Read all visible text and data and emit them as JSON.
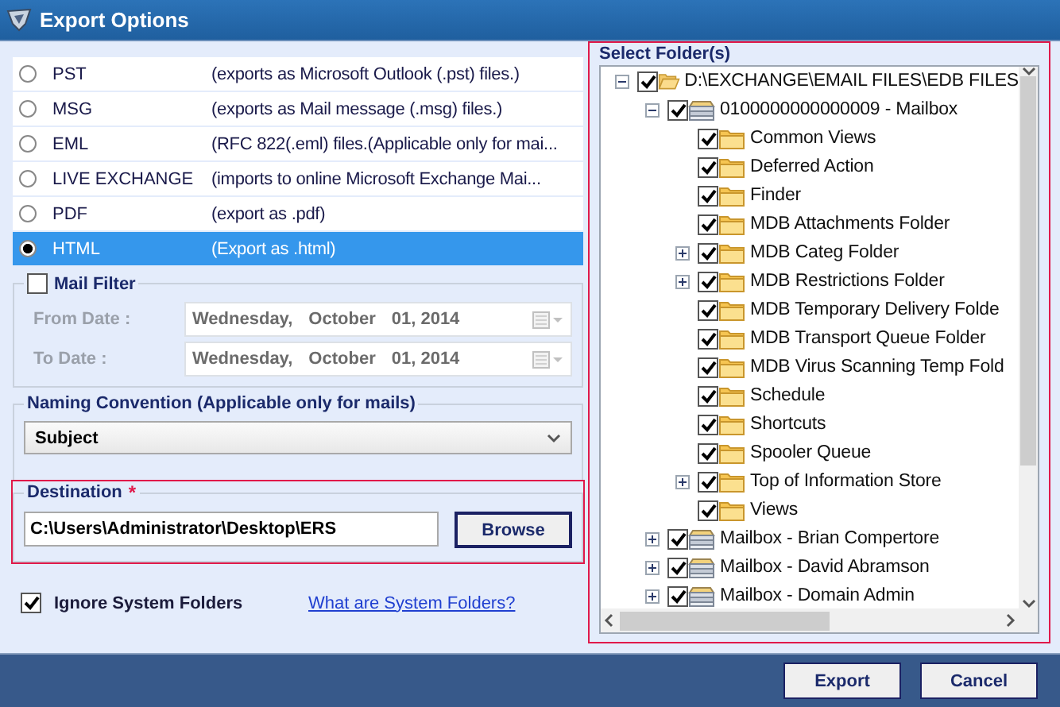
{
  "window": {
    "title": "Export Options"
  },
  "formats": [
    {
      "label": "PST",
      "description": "(exports as Microsoft Outlook (.pst) files.)",
      "selected": false
    },
    {
      "label": "MSG",
      "description": "(exports as Mail message (.msg) files.)",
      "selected": false
    },
    {
      "label": "EML",
      "description": "(RFC 822(.eml) files.(Applicable only for mai...",
      "selected": false
    },
    {
      "label": "LIVE EXCHANGE",
      "description": "(imports to online Microsoft Exchange Mai...",
      "selected": false
    },
    {
      "label": "PDF",
      "description": "(export as .pdf)",
      "selected": false
    },
    {
      "label": "HTML",
      "description": "(Export as .html)",
      "selected": true
    }
  ],
  "mail_filter": {
    "label": "Mail Filter",
    "checked": false,
    "dates": [
      {
        "label": "From Date :",
        "weekday": "Wednesday,",
        "month": "October",
        "day_year": "01, 2014"
      },
      {
        "label": "To Date :",
        "weekday": "Wednesday,",
        "month": "October",
        "day_year": "01, 2014"
      }
    ]
  },
  "naming": {
    "legend": "Naming Convention (Applicable only for mails)",
    "value": "Subject"
  },
  "destination": {
    "legend": "Destination",
    "required_mark": "*",
    "path": "C:\\Users\\Administrator\\Desktop\\ERS",
    "button": "Browse"
  },
  "ignore_system_folders": {
    "label": "Ignore System Folders",
    "checked": true
  },
  "help_link": "What are System Folders?",
  "folders": {
    "legend": "Select Folder(s)",
    "tree": [
      {
        "label": "D:\\EXCHANGE\\EMAIL FILES\\EDB FILES",
        "kind": "drive",
        "expanded": true,
        "checked": true,
        "children": [
          {
            "label": "0100000000000009 - Mailbox",
            "kind": "mailbox",
            "expanded": true,
            "checked": true,
            "children": [
              {
                "label": "Common Views",
                "kind": "folder",
                "checked": true
              },
              {
                "label": "Deferred Action",
                "kind": "folder",
                "checked": true
              },
              {
                "label": "Finder",
                "kind": "folder",
                "checked": true
              },
              {
                "label": "MDB Attachments Folder",
                "kind": "folder",
                "checked": true
              },
              {
                "label": "MDB Categ Folder",
                "kind": "folder",
                "expanded": false,
                "checked": true
              },
              {
                "label": "MDB Restrictions Folder",
                "kind": "folder",
                "expanded": false,
                "checked": true
              },
              {
                "label": "MDB Temporary Delivery Folde",
                "kind": "folder",
                "checked": true
              },
              {
                "label": "MDB Transport Queue Folder",
                "kind": "folder",
                "checked": true
              },
              {
                "label": "MDB Virus Scanning Temp Fold",
                "kind": "folder",
                "checked": true
              },
              {
                "label": "Schedule",
                "kind": "folder",
                "checked": true
              },
              {
                "label": "Shortcuts",
                "kind": "folder",
                "checked": true
              },
              {
                "label": "Spooler Queue",
                "kind": "folder",
                "checked": true
              },
              {
                "label": "Top of Information Store",
                "kind": "folder",
                "expanded": false,
                "checked": true
              },
              {
                "label": "Views",
                "kind": "folder",
                "checked": true
              }
            ]
          },
          {
            "label": "Mailbox - Brian Compertore",
            "kind": "mailbox",
            "expanded": false,
            "checked": true
          },
          {
            "label": "Mailbox - David Abramson",
            "kind": "mailbox",
            "expanded": false,
            "checked": true
          },
          {
            "label": "Mailbox - Domain Admin",
            "kind": "mailbox",
            "expanded": false,
            "checked": true
          }
        ]
      }
    ]
  },
  "buttons": [
    "Export",
    "Cancel"
  ]
}
